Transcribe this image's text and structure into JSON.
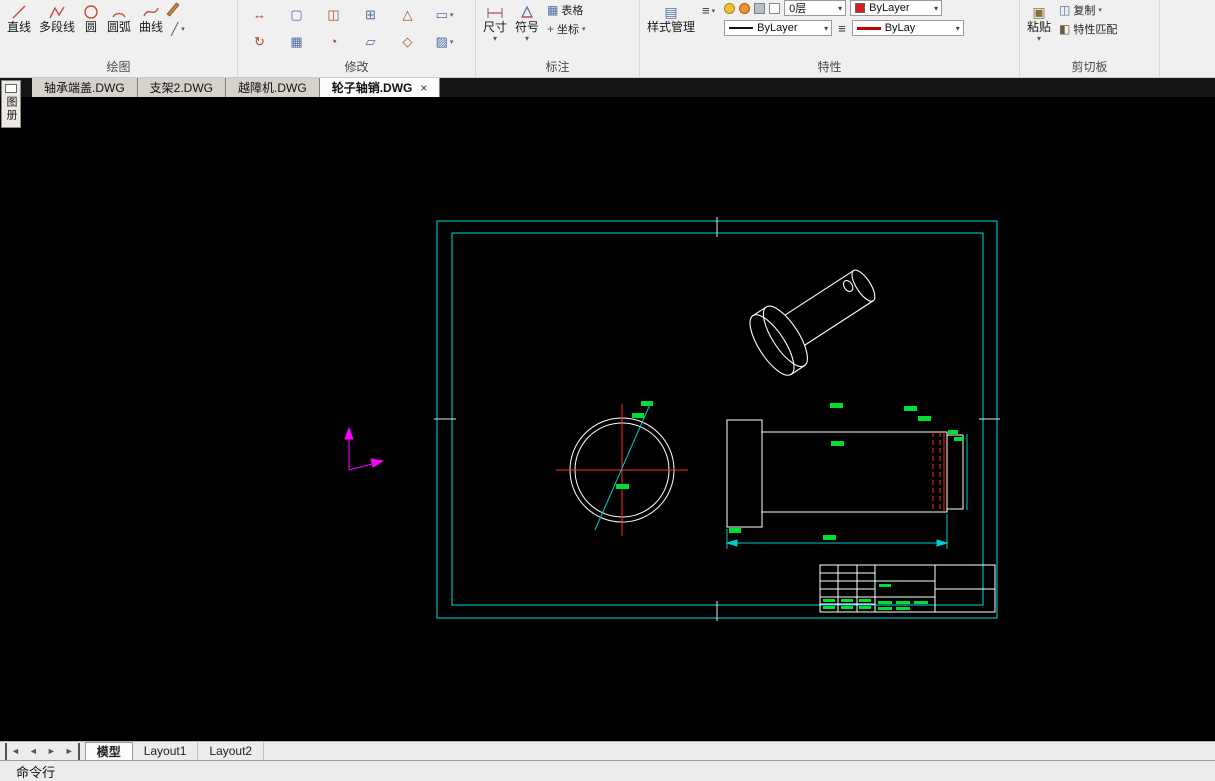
{
  "ribbon": {
    "draw": {
      "label": "绘图",
      "buttons": [
        {
          "label": "直线"
        },
        {
          "label": "多段线"
        },
        {
          "label": "圆"
        },
        {
          "label": "圆弧"
        },
        {
          "label": "曲线"
        }
      ]
    },
    "modify": {
      "label": "修改"
    },
    "annotate": {
      "label": "标注",
      "dimension": "尺寸",
      "symbol": "符号",
      "table": "表格",
      "coordinate": "坐标"
    },
    "properties": {
      "label": "特性",
      "style_manager": "样式管理",
      "layer": "0层",
      "color": "ByLayer",
      "linetype": "ByLayer",
      "lineweight": "ByLay"
    },
    "clipboard": {
      "label": "剪切板",
      "paste": "粘贴",
      "copy": "复制",
      "match_properties": "特性匹配"
    }
  },
  "icons": {
    "modify_row1": [
      "↔",
      "▢",
      "◫",
      "⊞",
      "△",
      "▭"
    ],
    "modify_row2": [
      "↻",
      "▦",
      "◔",
      "▱",
      "◇",
      "▨"
    ],
    "draw_extra": "╱",
    "menu": "≡",
    "table": "▦",
    "coordinate": "+",
    "style_manager": "▤",
    "paste": "▣",
    "copy": "◫",
    "match": "◧",
    "dropdown_arrow": "▾",
    "nav_prev": "◄",
    "nav_next": "►"
  },
  "doc_tabs": [
    {
      "label": "轴承端盖.DWG"
    },
    {
      "label": "支架2.DWG"
    },
    {
      "label": "越障机.DWG"
    },
    {
      "label": "轮子轴销.DWG",
      "close": "×"
    }
  ],
  "side_panel_tab": "图册",
  "layout_bar": {
    "tabs": [
      {
        "label": "模型"
      },
      {
        "label": "Layout1"
      },
      {
        "label": "Layout2"
      }
    ]
  },
  "command_bar": {
    "title": "命令行"
  },
  "colors": {
    "frame_cyan": "#00dcdc",
    "entity_white": "#ffffff",
    "centerline_red": "#ff3030",
    "grip_green": "#00dd33",
    "ucs_magenta": "#ff00ff",
    "hidden_red_dashed": "#ff3030"
  }
}
